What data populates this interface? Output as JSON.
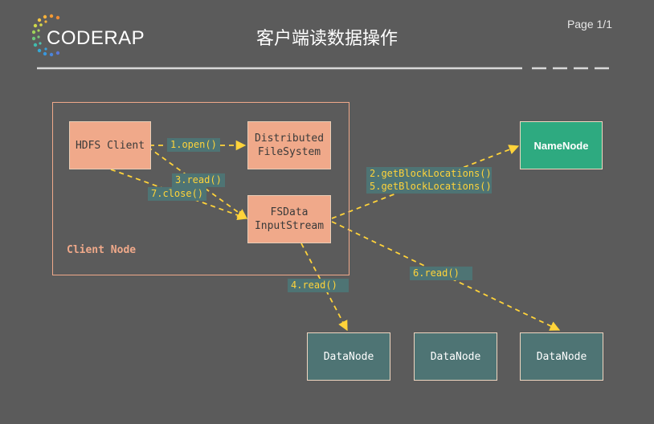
{
  "header": {
    "logo_text": "CODERAP",
    "title": "客户端读数据操作",
    "page": "Page 1/1"
  },
  "diagram": {
    "client_node_label": "Client Node",
    "nodes": {
      "hdfs_client": "HDFS Client",
      "distributed_fs": "Distributed\nFileSystem",
      "fsdata_input": "FSData\nInputStream",
      "namenode": "NameNode",
      "datanode_1": "DataNode",
      "datanode_2": "DataNode",
      "datanode_3": "DataNode"
    },
    "edges": {
      "open": "1.open()",
      "read3": "3.read()",
      "close": "7.close()",
      "get_block_2": "2.getBlockLocations()",
      "get_block_5": "5.getBlockLocations()",
      "read4": "4.read()",
      "read6": "6.read()"
    }
  },
  "colors": {
    "background": "#5b5b5b",
    "client_box": "#f0a98a",
    "namenode": "#2eaa80",
    "datanode": "#4e7474",
    "arrow": "#ffd33a"
  }
}
